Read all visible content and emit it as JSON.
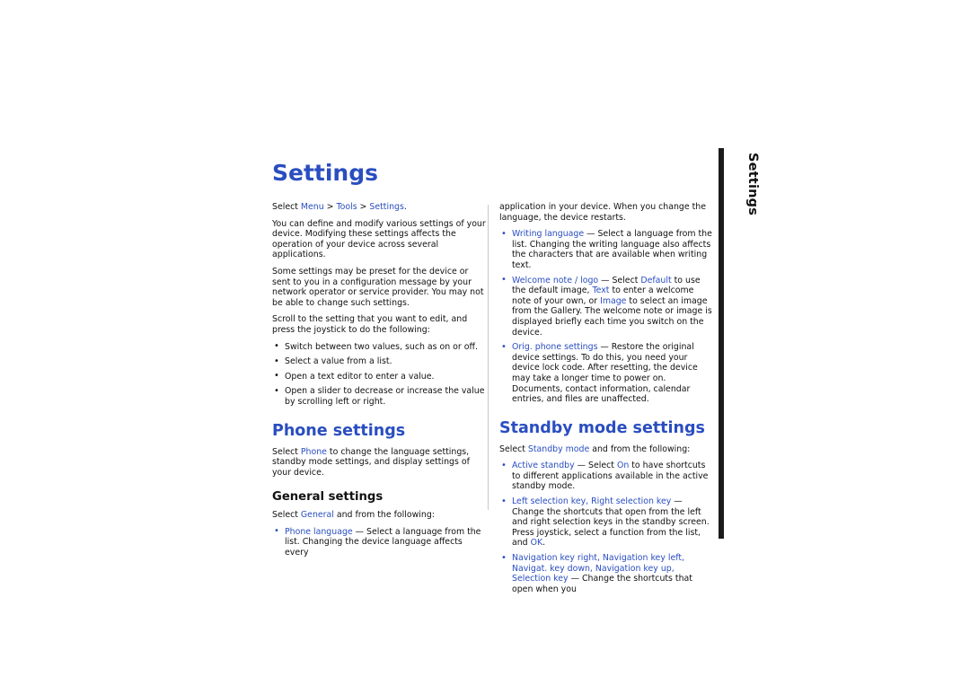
{
  "document": {
    "page_title": "Settings",
    "side_tab_label": "Settings",
    "left_column": {
      "intro_select": {
        "prefix": "Select ",
        "menu": "Menu",
        "sep1": " > ",
        "tools": "Tools",
        "sep2": " > ",
        "settings": "Settings",
        "suffix": "."
      },
      "para_define": "You can define and modify various settings of your device. Modifying these settings affects the operation of your device across several applications.",
      "para_preset": "Some settings may be preset for the device or sent to you in a configuration message by your network operator or service provider. You may not be able to change such settings.",
      "para_scroll": "Scroll to the setting that you want to edit, and press the joystick to do the following:",
      "bullets": [
        "Switch between two values, such as on or off.",
        "Select a value from a list.",
        "Open a text editor to enter a value.",
        "Open a slider to decrease or increase the value by scrolling left or right."
      ],
      "phone_settings_heading": "Phone settings",
      "phone_settings_para": {
        "prefix": "Select ",
        "link": "Phone",
        "suffix": " to change the language settings, standby mode settings, and display settings of your device."
      },
      "general_settings_heading": "General settings",
      "general_select": {
        "prefix": "Select ",
        "link": "General",
        "suffix": " and from the following:"
      },
      "general_bullet": {
        "term": "Phone language",
        "dash": " — ",
        "text": "Select a language from the list. Changing the device language affects every"
      }
    },
    "right_column": {
      "continuation": "application in your device. When you change the language, the device restarts.",
      "bullets": [
        {
          "term": "Writing language",
          "dash": " — ",
          "text": "Select a language from the list. Changing the writing language also affects the characters that are available when writing text."
        },
        {
          "term": "Welcome note / logo",
          "dash": " — ",
          "text_parts": [
            {
              "t": "Select ",
              "style": "black"
            },
            {
              "t": "Default",
              "style": "blue"
            },
            {
              "t": " to use the default image, ",
              "style": "black"
            },
            {
              "t": "Text",
              "style": "blue"
            },
            {
              "t": " to enter a welcome note of your own, or ",
              "style": "black"
            },
            {
              "t": "Image",
              "style": "blue"
            },
            {
              "t": " to select an image from the Gallery. The welcome note or image is displayed briefly each time you switch on the device.",
              "style": "black"
            }
          ]
        },
        {
          "term": "Orig. phone settings",
          "dash": " — ",
          "text": "Restore the original device settings. To do this, you need your device lock code. After resetting, the device may take a longer time to power on. Documents, contact information, calendar entries, and files are unaffected."
        }
      ],
      "standby_heading": "Standby mode settings",
      "standby_select": {
        "prefix": "Select ",
        "link": "Standby mode",
        "suffix": " and from the following:"
      },
      "standby_bullets": [
        {
          "term": "Active standby",
          "dash": " — ",
          "text_parts": [
            {
              "t": "Select ",
              "style": "black"
            },
            {
              "t": "On",
              "style": "blue"
            },
            {
              "t": " to have shortcuts to different applications available in the active standby mode.",
              "style": "black"
            }
          ]
        },
        {
          "term": "Left selection key, Right selection key",
          "dash": " — ",
          "text_parts": [
            {
              "t": "Change the shortcuts that open from the left and right selection keys in the standby screen. Press joystick, select a function from the list, and ",
              "style": "black"
            },
            {
              "t": "OK",
              "style": "blue"
            },
            {
              "t": ".",
              "style": "black"
            }
          ]
        },
        {
          "term": "Navigation key right, Navigation key left, Navigat. key down, Navigation key up, Selection key",
          "dash": " — ",
          "text": "Change the shortcuts that open when you"
        }
      ]
    },
    "colors": {
      "link_blue": "#2a4ec0",
      "body_black": "#111111",
      "tab_dark": "#1b1b1b"
    }
  }
}
